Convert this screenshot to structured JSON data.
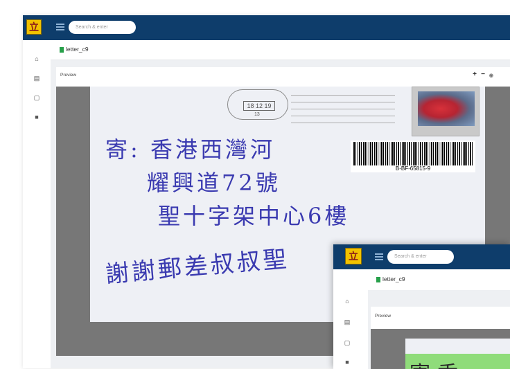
{
  "app": {
    "logo_glyph": "立",
    "search_placeholder": "Search & enter",
    "file_tab_label": "letter_c9",
    "preview_title": "Preview",
    "preview_controls": {
      "zoom_in": "+",
      "zoom_out": "−",
      "eye": "◉"
    },
    "nav_icons": [
      "home-icon",
      "list-icon",
      "document-icon",
      "folder-icon"
    ]
  },
  "document": {
    "postmark_date": "18 12 19",
    "postmark_number": "13",
    "barcode_text": "B-BF-65815-9",
    "handwriting": {
      "line1": "寄: 香港西灣河",
      "line2": "耀興道72號",
      "line3": "聖十字架中心6樓",
      "line4": "謝謝郵差叔叔聖"
    }
  },
  "overlay": {
    "logo_glyph": "立",
    "search_placeholder": "Search & enter",
    "file_tab_label": "letter_c9",
    "preview_title": "Preview",
    "highlight_text": "寄:香"
  },
  "colors": {
    "topbar": "#0e3d6b",
    "logo_bg": "#f2c200",
    "ink": "#3a3ab0",
    "highlight": "#8fdc7a"
  }
}
